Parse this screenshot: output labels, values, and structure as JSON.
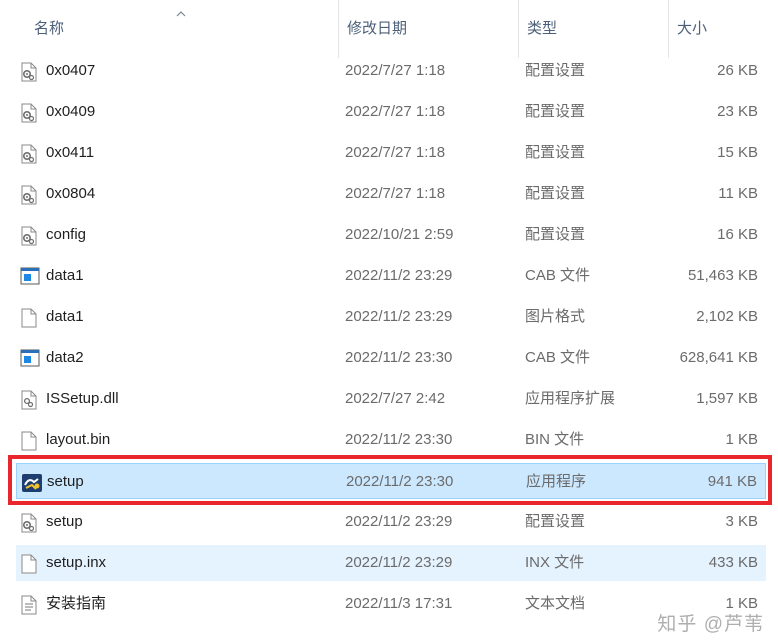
{
  "columns": {
    "name": "名称",
    "date": "修改日期",
    "type": "类型",
    "size": "大小"
  },
  "files": [
    {
      "name": "0x0407",
      "date": "2022/7/27 1:18",
      "type": "配置设置",
      "size": "26 KB",
      "icon": "settings-file-icon"
    },
    {
      "name": "0x0409",
      "date": "2022/7/27 1:18",
      "type": "配置设置",
      "size": "23 KB",
      "icon": "settings-file-icon"
    },
    {
      "name": "0x0411",
      "date": "2022/7/27 1:18",
      "type": "配置设置",
      "size": "15 KB",
      "icon": "settings-file-icon"
    },
    {
      "name": "0x0804",
      "date": "2022/7/27 1:18",
      "type": "配置设置",
      "size": "11 KB",
      "icon": "settings-file-icon"
    },
    {
      "name": "config",
      "date": "2022/10/21 2:59",
      "type": "配置设置",
      "size": "16 KB",
      "icon": "settings-file-icon"
    },
    {
      "name": "data1",
      "date": "2022/11/2 23:29",
      "type": "CAB 文件",
      "size": "51,463 KB",
      "icon": "cab-file-icon"
    },
    {
      "name": "data1",
      "date": "2022/11/2 23:29",
      "type": "图片格式",
      "size": "2,102 KB",
      "icon": "blank-file-icon"
    },
    {
      "name": "data2",
      "date": "2022/11/2 23:30",
      "type": "CAB 文件",
      "size": "628,641 KB",
      "icon": "cab-file-icon"
    },
    {
      "name": "ISSetup.dll",
      "date": "2022/7/27 2:42",
      "type": "应用程序扩展",
      "size": "1,597 KB",
      "icon": "dll-file-icon"
    },
    {
      "name": "layout.bin",
      "date": "2022/11/2 23:30",
      "type": "BIN 文件",
      "size": "1 KB",
      "icon": "blank-file-icon"
    },
    {
      "name": "setup",
      "date": "2022/11/2 23:30",
      "type": "应用程序",
      "size": "941 KB",
      "icon": "setup-exe-icon"
    },
    {
      "name": "setup",
      "date": "2022/11/2 23:29",
      "type": "配置设置",
      "size": "3 KB",
      "icon": "settings-file-icon"
    },
    {
      "name": "setup.inx",
      "date": "2022/11/2 23:29",
      "type": "INX 文件",
      "size": "433 KB",
      "icon": "blank-file-icon"
    },
    {
      "name": "安装指南",
      "date": "2022/11/3 17:31",
      "type": "文本文档",
      "size": "1 KB",
      "icon": "text-file-icon"
    }
  ],
  "watermark": "知乎 @芦苇",
  "colors": {
    "selected_bg": "#cce8ff",
    "hover_bg": "#e5f3ff",
    "highlight_border": "#e8262c"
  }
}
